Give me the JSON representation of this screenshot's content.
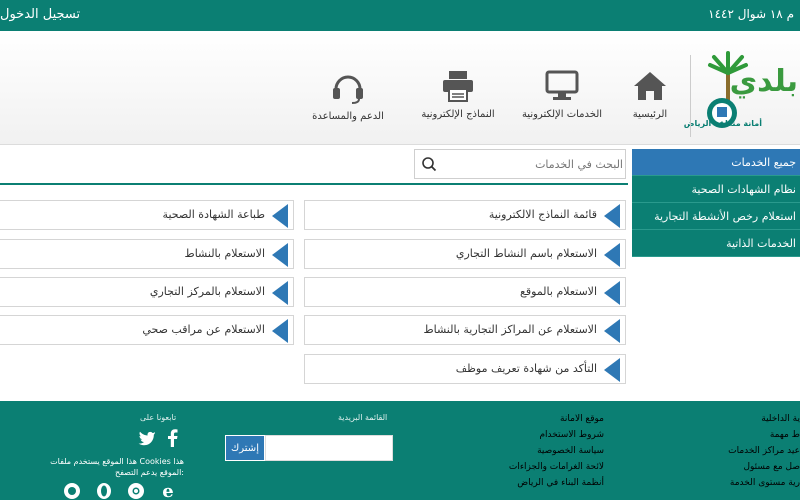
{
  "topbar": {
    "login": "تسجيل الدخول",
    "date": "م ١٨ شوال ١٤٤٢"
  },
  "header": {
    "logo_text": "بلدي",
    "logo_caption": "أمانة منطقة الرياض",
    "nav": [
      {
        "label": "الرئيسية",
        "icon": "home-icon"
      },
      {
        "label": "الخدمات الإلكترونية",
        "icon": "monitor-icon"
      },
      {
        "label": "النماذج الإلكترونية",
        "icon": "printer-icon"
      },
      {
        "label": "الدعم والمساعدة",
        "icon": "headset-icon"
      }
    ]
  },
  "search": {
    "placeholder": "البحث في الخدمات"
  },
  "sidebar": {
    "items": [
      {
        "label": "جميع الخدمات"
      },
      {
        "label": "نظام الشهادات الصحية"
      },
      {
        "label": "استعلام رخص الأنشطة التجارية"
      },
      {
        "label": "الخدمات الذاتية"
      }
    ]
  },
  "services": {
    "col1": [
      {
        "label": "قائمة النماذج الالكترونية"
      },
      {
        "label": "الاستعلام باسم النشاط التجاري"
      },
      {
        "label": "الاستعلام بالموقع"
      },
      {
        "label": "الاستعلام عن المراكز التجارية بالنشاط"
      },
      {
        "label": "التأكد من شهادة تعريف موظف"
      }
    ],
    "col2": [
      {
        "label": "طباعة الشهادة الصحية"
      },
      {
        "label": "الاستعلام بالنشاط"
      },
      {
        "label": "الاستعلام بالمركز التجاري"
      },
      {
        "label": "الاستعلام عن مراقب صحي"
      }
    ]
  },
  "footer": {
    "col_right": [
      "ية الداخلية",
      "ط مهمة",
      "عيد مراكز الخدمات",
      "صل مع مسئول",
      "رية مستوى الخدمة"
    ],
    "col_links": [
      "موقع الامانة",
      "شروط الاستخدام",
      "سياسة الخصوصية",
      "لائحة الغرامات والجزاءات",
      "أنظمة البناء في الرياض"
    ],
    "newsletter_title": "القائمة البريدية",
    "subscribe_label": "إشترك",
    "follow_title": "تابعونا على",
    "cookie_text": "هذا الموقع يستخدم ملفات Cookies هذا الموقع يدعم التصفح:"
  },
  "colors": {
    "primary": "#0b7f73",
    "accent": "#2e78b5"
  }
}
